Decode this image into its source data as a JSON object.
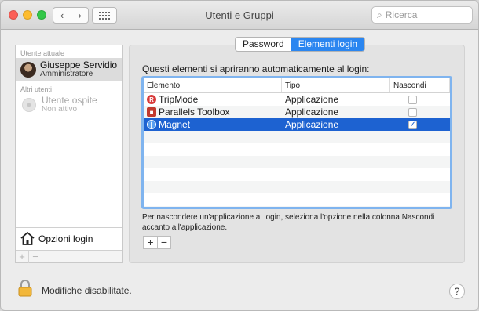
{
  "window": {
    "title": "Utenti e Gruppi"
  },
  "search": {
    "placeholder": "Ricerca"
  },
  "sidebar": {
    "current_user_header": "Utente attuale",
    "current_user": {
      "name": "Giuseppe Servidio",
      "role": "Amministratore"
    },
    "other_users_header": "Altri utenti",
    "guest_user": {
      "name": "Utente ospite",
      "status": "Non attivo"
    },
    "login_options_label": "Opzioni login",
    "add_label": "+",
    "remove_label": "−"
  },
  "tabs": [
    {
      "label": "Password",
      "active": false
    },
    {
      "label": "Elementi login",
      "active": true
    }
  ],
  "main": {
    "intro": "Questi elementi si apriranno automaticamente al login:",
    "columns": {
      "item": "Elemento",
      "type": "Tipo",
      "hide": "Nascondi"
    },
    "rows": [
      {
        "name": "TripMode",
        "type": "Applicazione",
        "hide": false,
        "icon": "tripmode-icon"
      },
      {
        "name": "Parallels Toolbox",
        "type": "Applicazione",
        "hide": false,
        "icon": "parallels-toolbox-icon"
      },
      {
        "name": "Magnet",
        "type": "Applicazione",
        "hide": true,
        "icon": "magnet-icon"
      }
    ],
    "help_text": "Per nascondere un'applicazione al login, seleziona l'opzione nella colonna Nascondi accanto all'applicazione.",
    "add_label": "+",
    "remove_label": "−"
  },
  "footer": {
    "lock_text": "Modifiche disabilitate.",
    "help_label": "?"
  },
  "colors": {
    "accent": "#2b86f0",
    "selection": "#1d62d1",
    "focus_ring": "#7fb4ef"
  }
}
